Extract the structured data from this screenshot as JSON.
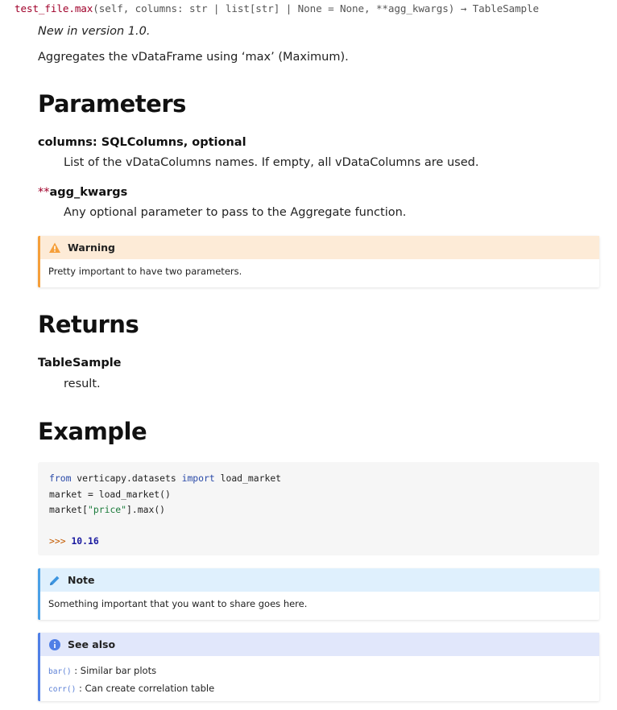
{
  "signature": {
    "name": "test_file.max",
    "params": "(self, columns: str | list[str] | None = None, **agg_kwargs) → TableSample"
  },
  "version_note": "New in version 1.0.",
  "description": "Aggregates the vDataFrame using ‘max’ (Maximum).",
  "parameters": {
    "heading": "Parameters",
    "items": [
      {
        "stars": "",
        "name": "columns: SQLColumns, optional",
        "desc": "List of the vDataColumns names. If empty, all vDataColumns are used."
      },
      {
        "stars": "**",
        "name": "agg_kwargs",
        "desc": "Any optional parameter to pass to the Aggregate function."
      }
    ]
  },
  "warning": {
    "title": "Warning",
    "text": "Pretty important to have two parameters.",
    "icon": "warning-triangle-icon",
    "color": "#f59f3a"
  },
  "returns": {
    "heading": "Returns",
    "type": "TableSample",
    "desc": "result."
  },
  "example": {
    "heading": "Example",
    "line1": {
      "kw_from": "from",
      "module": " verticapy.datasets ",
      "kw_import": "import",
      "name": " load_market"
    },
    "line2": "market = load_market()",
    "line3": {
      "pre": "market[",
      "str": "\"price\"",
      "post": "].max()"
    },
    "prompt": ">>>",
    "result": "10.16"
  },
  "note": {
    "title": "Note",
    "text": "Something important that you want to share goes here.",
    "icon": "pencil-icon",
    "color": "#4aa0e6"
  },
  "see_also": {
    "title": "See also",
    "icon": "info-circle-icon",
    "items": [
      {
        "ref": "bar()",
        "desc": " : Similar bar plots"
      },
      {
        "ref": "corr()",
        "desc": " : Can create correlation table"
      }
    ]
  }
}
